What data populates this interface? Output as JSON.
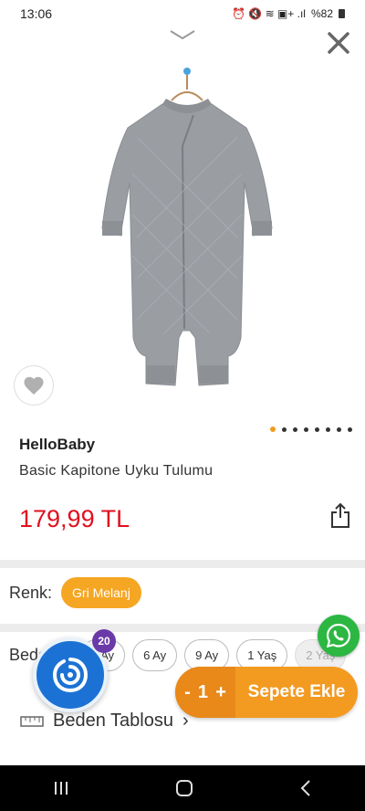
{
  "status_bar": {
    "time": "13:06",
    "indicators": "⏰ 🔇 ≋ ▣+ .ıl",
    "battery": "%82"
  },
  "icons": {
    "collapse": "chevron-down-icon",
    "close": "close-icon",
    "favorite": "heart-icon",
    "share": "share-icon",
    "whatsapp": "whatsapp-icon",
    "size_table": "ruler-icon",
    "app": "app-logo-icon"
  },
  "product": {
    "image_label": "Gri Melanj kapitone uyku tulumu",
    "brand": "HelloBaby",
    "name": "Basic Kapitone Uyku Tulumu",
    "price": "179,99 TL",
    "image_count": 8,
    "image_index": 0
  },
  "color": {
    "label": "Renk:",
    "selected": "Gri Melanj"
  },
  "size": {
    "label": "Beden",
    "options": [
      "3 Ay",
      "6 Ay",
      "9 Ay",
      "1 Yaş",
      "2 Yaş"
    ]
  },
  "size_table": {
    "label": "Beden Tablosu",
    "chevron": "›"
  },
  "cart": {
    "minus": "-",
    "quantity": "1",
    "plus": "+",
    "add_label": "Sepete Ekle"
  },
  "app_badge": {
    "count": "20"
  },
  "colors": {
    "accent": "#f39a21",
    "price": "#e0101f",
    "whatsapp": "#2cb742",
    "app_blue": "#1c72d4",
    "badge_purple": "#6a3aa8"
  }
}
